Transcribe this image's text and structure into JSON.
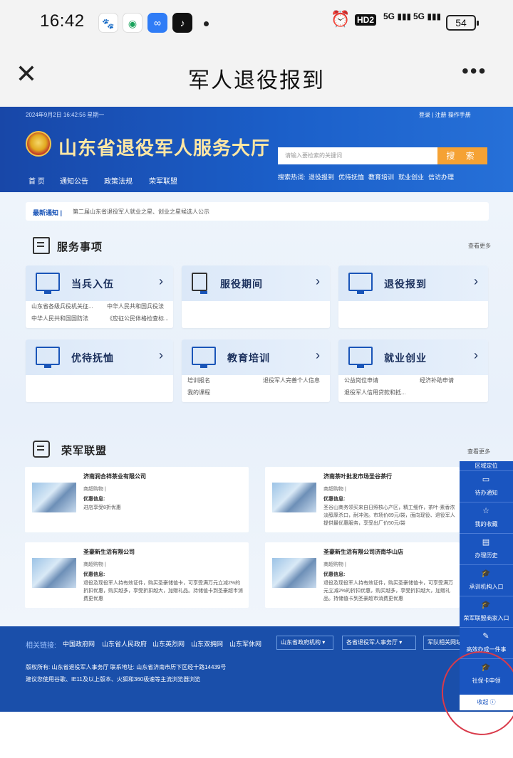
{
  "status_bar": {
    "time": "16:42",
    "hd": "HD2",
    "signal1": "5G",
    "signal2": "5G",
    "battery": "54"
  },
  "app_bar": {
    "close_icon": "close-icon",
    "title": "军人退役报到",
    "more_icon": "more-icon"
  },
  "site_header": {
    "date": "2024年9月2日 16:42:56 星期一",
    "login": "登录 | 注册  操作手册",
    "site_name": "山东省退役军人服务大厅",
    "search_placeholder": "请输入要检索的关键词",
    "search_button": "搜 索",
    "nav": [
      "首 页",
      "通知公告",
      "政策法规",
      "荣军联盟"
    ],
    "hot_label": "搜索热词:",
    "hot_words": [
      "退役报到",
      "优待抚恤",
      "教育培训",
      "就业创业",
      "信访办理"
    ]
  },
  "notice": {
    "label": "最新通知 |",
    "text": "第二届山东省退役军人就业之星、创业之星候选人公示"
  },
  "services": {
    "title": "服务事项",
    "more": "查看更多",
    "cards": [
      {
        "title": "当兵入伍",
        "links": [
          "山东省各级兵役机关征...",
          "中华人民共和国兵役法",
          "中华人民共和国国防法",
          "《应征公民体格检查标..."
        ]
      },
      {
        "title": "服役期间",
        "links": []
      },
      {
        "title": "退役报到",
        "links": []
      },
      {
        "title": "优待抚恤",
        "links": []
      },
      {
        "title": "教育培训",
        "links": [
          "培训报名",
          "退役军人完善个人信息",
          "我的课程"
        ]
      },
      {
        "title": "就业创业",
        "links": [
          "公益岗位申请",
          "经济补助申请",
          "退役军人信用贷款和抵..."
        ]
      }
    ]
  },
  "alliance": {
    "title": "荣军联盟",
    "more": "查看更多",
    "merchants": [
      {
        "name": "济南润合祥茶业有限公司",
        "category": "商超购物 |",
        "label": "优惠信息:",
        "desc": "进店享受8折优惠"
      },
      {
        "name": "济南茶叶批发市场圣谷茶行",
        "category": "商超购物 |",
        "label": "优惠信息:",
        "desc": "圣谷山商务领买来自日照核心产区，精工细作，茶叶·素香浓淡醇厚杀口，耐冲泡。市场价89元/袋，面向现役、退役军人提供最优惠服务，享受出厂价50元/袋"
      },
      {
        "name": "圣豪新生活有限公司",
        "category": "商超购物 |",
        "label": "优惠信息:",
        "desc": "退役及现役军人持有效证件，购买圣豪储值卡，可享受满万元立减2%的折扣优惠，购买越多，享受折扣越大，加赠礼品。持储值卡到圣豪超市消费更优惠"
      },
      {
        "name": "圣豪新生活有限公司济南华山店",
        "category": "商超购物 |",
        "label": "优惠信息:",
        "desc": "退役及现役军人持有效证件，购买圣豪储值卡，可享受满万元立减2%的折扣优惠，购买越多，享受折扣越大，加赠礼品。持储值卡到圣豪超市消费更优惠"
      }
    ]
  },
  "footer": {
    "related_label": "相关链接:",
    "links": [
      "中国政府网",
      "山东省人民政府",
      "山东英烈网",
      "山东双拥网",
      "山东军休网"
    ],
    "selects": [
      "山东省政府机构",
      "各省退役军人事务厅",
      "军队相关网站"
    ],
    "copyright": "版权所有: 山东省退役军人事务厅  联系地址: 山东省济南市历下区经十路14439号",
    "browser_tip": "建议您使用谷歌、IE11及以上版本、火狐和360极速等主流浏览器浏览"
  },
  "side_panel": {
    "top_partial": "区域定位",
    "items": [
      "待办通知",
      "我的收藏",
      "办理历史",
      "承训机构入口",
      "荣军联盟商家入口",
      "高效办成一件事",
      "社保卡申领"
    ],
    "collapse": "收起 ⓘ"
  },
  "colors": {
    "header_blue": "#1b5fc9",
    "search_orange": "#f5a234",
    "side_blue": "#1a55c0",
    "annotation_red": "#d93a4a"
  }
}
